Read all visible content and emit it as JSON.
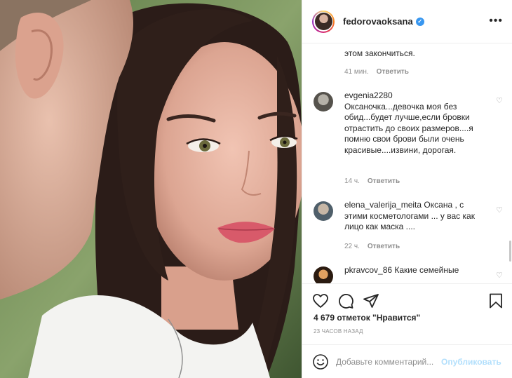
{
  "post": {
    "username": "fedorovaoksana",
    "verified": true,
    "more_icon": "ellipsis-icon"
  },
  "comments_panel": {
    "tail_text": "этом закончиться.",
    "tail_meta": {
      "time": "41 мин.",
      "reply": "Ответить"
    },
    "comments": [
      {
        "user": "evgenia2280",
        "text": "Оксаночка...девочка моя без обид...будет лучше,если бровки отрастить до своих размеров....я помню свои брови были очень красивые....извини, дорогая.",
        "time": "14 ч.",
        "reply": "Ответить"
      },
      {
        "user": "elena_valerija_meita",
        "text": "Оксана , с этими косметологами ... у вас как лицо как маска ....",
        "time": "22 ч.",
        "reply": "Ответить"
      },
      {
        "user": "pkravcov_86",
        "text": "Какие семейные",
        "time": "",
        "reply": ""
      }
    ]
  },
  "actions": {
    "like_icon": "heart-icon",
    "comment_icon": "comment-icon",
    "share_icon": "send-icon",
    "save_icon": "bookmark-icon"
  },
  "likes_text": "4 679 отметок \"Нравится\"",
  "time_ago": "23 ЧАСОВ НАЗАД",
  "add_comment": {
    "placeholder": "Добавьте комментарий...",
    "publish_label": "Опубликовать",
    "emoji_icon": "smiley-icon"
  },
  "colors": {
    "text": "#262626",
    "secondary": "#8e8e8e",
    "verified": "#3897f0",
    "publish_disabled": "#b2dffc"
  }
}
